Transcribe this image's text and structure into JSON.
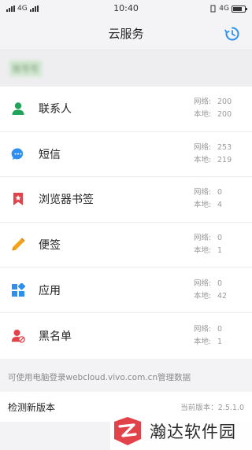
{
  "status_bar": {
    "left_text": "4G",
    "time": "10:40",
    "right_text": "4G"
  },
  "header": {
    "title": "云服务",
    "history_icon": "history-clock-icon"
  },
  "account": {
    "name": "账号号"
  },
  "items": [
    {
      "label": "联系人",
      "icon": "contact-icon",
      "color": "#21a45a",
      "net_key": "网络:",
      "net_val": "200",
      "local_key": "本地:",
      "local_val": "200"
    },
    {
      "label": "短信",
      "icon": "sms-icon",
      "color": "#2d8ff0",
      "net_key": "网络:",
      "net_val": "253",
      "local_key": "本地:",
      "local_val": "219"
    },
    {
      "label": "浏览器书签",
      "icon": "bookmark-icon",
      "color": "#e2424a",
      "net_key": "网络:",
      "net_val": "0",
      "local_key": "本地:",
      "local_val": "4"
    },
    {
      "label": "便签",
      "icon": "pencil-icon",
      "color": "#f3a41c",
      "net_key": "网络:",
      "net_val": "0",
      "local_key": "本地:",
      "local_val": "1"
    },
    {
      "label": "应用",
      "icon": "apps-icon",
      "color": "#2d8ff0",
      "net_key": "网络:",
      "net_val": "0",
      "local_key": "本地:",
      "local_val": "42"
    },
    {
      "label": "黑名单",
      "icon": "blacklist-icon",
      "color": "#e2424a",
      "net_key": "网络:",
      "net_val": "0",
      "local_key": "本地:",
      "local_val": "1"
    }
  ],
  "footer_note": "可使用电脑登录webcloud.vivo.com.cn管理数据",
  "update": {
    "label": "检测新版本",
    "version": "当前版本：2.5.1.0"
  },
  "watermark": {
    "text": "瀚达软件园"
  },
  "colors": {
    "accent": "#2d8ff0",
    "background": "#f3f3f5"
  }
}
